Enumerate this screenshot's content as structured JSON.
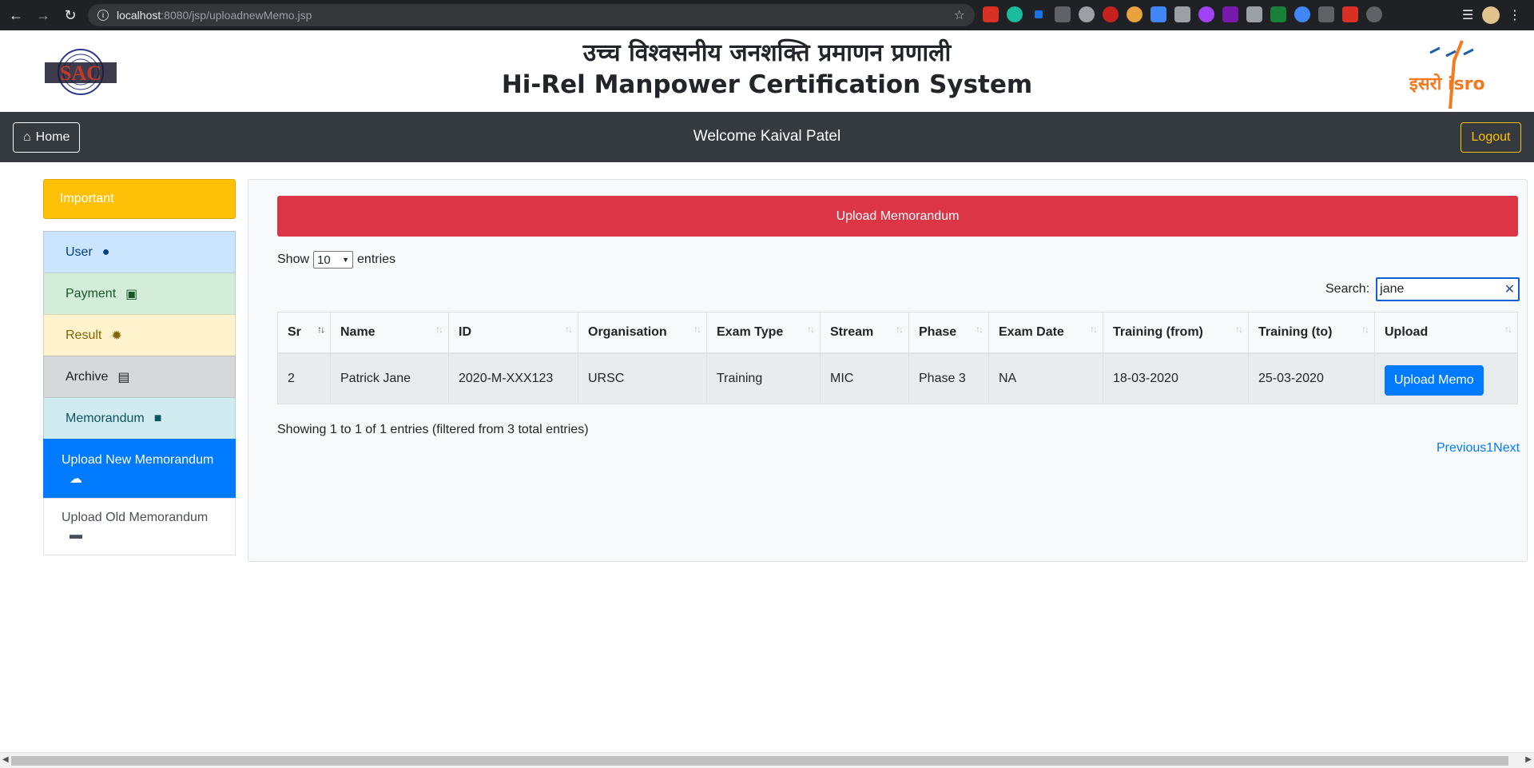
{
  "browser": {
    "url_host": "localhost",
    "url_path": ":8080/jsp/uploadnewMemo.jsp"
  },
  "header": {
    "title_hindi": "उच्च विश्वसनीय जनशक्ति प्रमाणन प्रणाली",
    "title_english": "Hi-Rel Manpower Certification System",
    "logo_left_text": "SAC",
    "logo_right_text": "इसरो isro"
  },
  "navbar": {
    "home_label": "Home",
    "welcome_text": "Welcome Kaival Patel",
    "logout_label": "Logout"
  },
  "sidebar": {
    "important_label": "Important",
    "items": [
      {
        "label": "User",
        "icon": "user-icon"
      },
      {
        "label": "Payment",
        "icon": "money-icon"
      },
      {
        "label": "Result",
        "icon": "certificate-icon"
      },
      {
        "label": "Archive",
        "icon": "archive-icon"
      },
      {
        "label": "Memorandum",
        "icon": "sticky-note-icon"
      },
      {
        "label": "Upload New Memorandum",
        "icon": "cloud-upload-icon"
      },
      {
        "label": "Upload Old Memorandum",
        "icon": "folder-icon"
      }
    ]
  },
  "main": {
    "banner": "Upload Memorandum",
    "show_label": "Show",
    "entries_label": "entries",
    "page_length": "10",
    "search_label": "Search:",
    "search_value": "jane",
    "columns": [
      "Sr",
      "Name",
      "ID",
      "Organisation",
      "Exam Type",
      "Stream",
      "Phase",
      "Exam Date",
      "Training (from)",
      "Training (to)",
      "Upload"
    ],
    "rows": [
      {
        "sr": "2",
        "name": "Patrick Jane",
        "id": "2020-M-XXX123",
        "organisation": "URSC",
        "exam_type": "Training",
        "stream": "MIC",
        "phase": "Phase 3",
        "exam_date": "NA",
        "training_from": "18-03-2020",
        "training_to": "25-03-2020",
        "upload_label": "Upload Memo"
      }
    ],
    "info": "Showing 1 to 1 of 1 entries (filtered from 3 total entries)",
    "paging": {
      "previous": "Previous",
      "page": "1",
      "next": "Next"
    }
  },
  "colors": {
    "navbar": "#343a40",
    "important": "#ffc107",
    "banner": "#dc3545",
    "active": "#007bff"
  }
}
